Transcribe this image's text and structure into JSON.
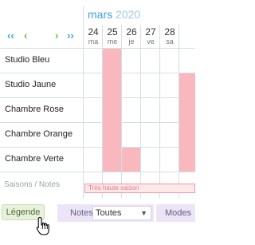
{
  "calendar": {
    "month": "mars",
    "year": "2020",
    "days": [
      {
        "num": "24",
        "name": "ma"
      },
      {
        "num": "25",
        "name": "me"
      },
      {
        "num": "26",
        "name": "je"
      },
      {
        "num": "27",
        "name": "ve"
      },
      {
        "num": "28",
        "name": "sa"
      }
    ],
    "nav": {
      "first": "‹‹",
      "prev": "‹",
      "next": "›",
      "last": "››"
    },
    "rooms": [
      "Studio Bleu",
      "Studio Jaune",
      "Chambre Rose",
      "Chambre Orange",
      "Chambre Verte"
    ],
    "seasons_label": "Saisons / Notes",
    "season_bar": "Très haute saison",
    "colors": {
      "booked": "#f9b8bd",
      "accent": "#3f9fdd"
    }
  },
  "toolbar": {
    "legend_button": "Légende",
    "notes_label": "Notes",
    "notes_value": "Toutes",
    "modes_label": "Modes"
  }
}
